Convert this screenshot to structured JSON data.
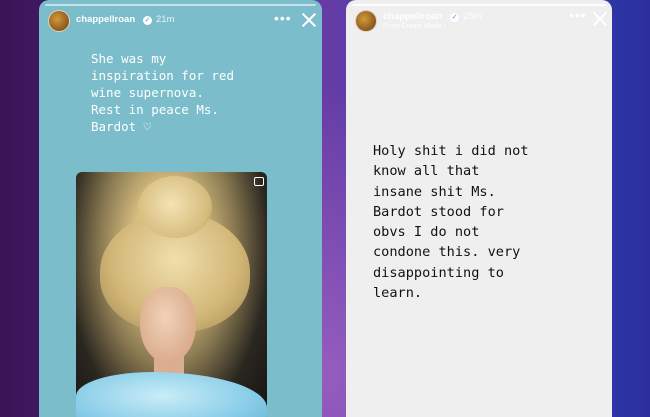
{
  "stories": [
    {
      "username": "chappellroan",
      "time": "21m",
      "caption": "She was my\ninspiration for red\nwine supernova.\nRest in peace Ms.\nBardot ♡",
      "colors": {
        "background": "#7bbdcb",
        "text": "#ffffff"
      },
      "icons": [
        "verified-badge-icon",
        "more-options-icon",
        "close-icon",
        "photo-overlay-icon"
      ]
    },
    {
      "username": "chappellroan",
      "time": "25m",
      "subtitle": "From Create Mode ›",
      "caption": "Holy shit i did not\nknow all that\ninsane shit Ms.\nBardot stood for\nobvs I do not\ncondone this.  very\ndisappointing to\nlearn.",
      "colors": {
        "background": "#efefef",
        "text": "#111111"
      },
      "icons": [
        "verified-badge-icon",
        "more-options-icon",
        "close-icon"
      ]
    }
  ],
  "ui": {
    "more_glyph": "•••",
    "verified_glyph": "✓"
  }
}
